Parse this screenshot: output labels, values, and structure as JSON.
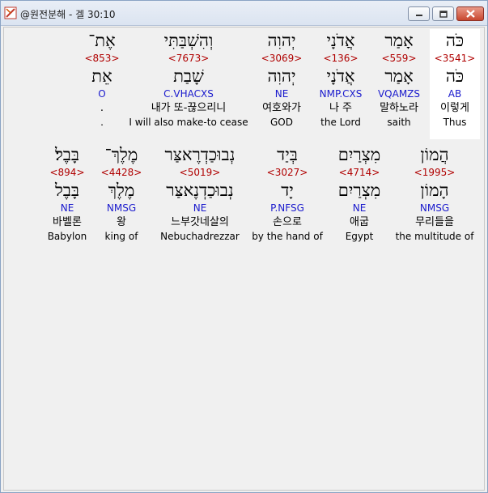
{
  "window": {
    "title": "@원전분해 - 겔 30:10",
    "icon": "tool-icon",
    "buttons": {
      "minimize": "minimize-icon",
      "maximize": "maximize-icon",
      "close": "close-icon"
    }
  },
  "rows": [
    {
      "words": [
        {
          "hebrew": "כֹּה",
          "strong": "<3541>",
          "lemma": "כֹּה",
          "morph": "AB",
          "korean": "이렇게",
          "english": "Thus",
          "selected": true
        },
        {
          "hebrew": "אָמַר",
          "strong": "<559>",
          "lemma": "אָמַר",
          "morph": "VQAMZS",
          "korean": "말하노라",
          "english": "saith"
        },
        {
          "hebrew": "אֲדֹנָי",
          "strong": "<136>",
          "lemma": "אֲדֹנָי",
          "morph": "NMP.CXS",
          "korean": "나 주",
          "english": "the Lord"
        },
        {
          "hebrew": "יְהוִה",
          "strong": "<3069>",
          "lemma": "יְהוִה",
          "morph": "NE",
          "korean": "여호와가",
          "english": "GOD"
        },
        {
          "hebrew": "וְהִשְׁבַּתִּי",
          "strong": "<7673>",
          "lemma": "שָׁבַת",
          "morph": "C.VHACXS",
          "korean": "내가 또-끊으리니",
          "english": "I will also make-to cease"
        },
        {
          "hebrew": "אֶת־",
          "strong": "<853>",
          "lemma": "אֵת",
          "morph": "O",
          "korean": ".",
          "english": "."
        }
      ]
    },
    {
      "words": [
        {
          "hebrew": "הֲמוֹן",
          "strong": "<1995>",
          "lemma": "הָמוֹן",
          "morph": "NMSG",
          "korean": "무리들을",
          "english": "the multitude of"
        },
        {
          "hebrew": "מִצְרַיִם",
          "strong": "<4714>",
          "lemma": "מִצְרַיִם",
          "morph": "NE",
          "korean": "애굽",
          "english": "Egypt"
        },
        {
          "hebrew": "בְּיַד",
          "strong": "<3027>",
          "lemma": "יָד",
          "morph": "P.NFSG",
          "korean": "손으로",
          "english": "by the hand of"
        },
        {
          "hebrew": "נְבוּכַדְרֶאצַּר",
          "strong": "<5019>",
          "lemma": "נְבוּכַדְנֶאצַּר",
          "morph": "NE",
          "korean": "느부갓네살의",
          "english": "Nebuchadrezzar"
        },
        {
          "hebrew": "מֶלֶךְ־",
          "strong": "<4428>",
          "lemma": "מֶלֶךְ",
          "morph": "NMSG",
          "korean": "왕",
          "english": "king of"
        },
        {
          "hebrew": "בָּבֶל׃",
          "strong": "<894>",
          "lemma": "בָּבֶל",
          "morph": "NE",
          "korean": "바벨론",
          "english": "Babylon"
        }
      ]
    }
  ]
}
